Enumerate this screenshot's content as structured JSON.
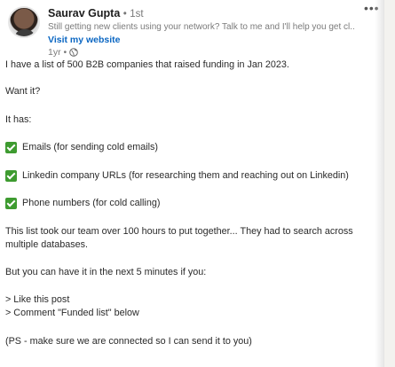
{
  "author": {
    "name": "Saurav Gupta",
    "separator": "•",
    "degree": "1st",
    "headline": "Still getting new clients using your network? Talk to me and I'll help you get cl...",
    "website_link": "Visit my website",
    "time_ago": "1yr •"
  },
  "icons": {
    "menu": "more-horizontal-icon",
    "visibility": "globe-icon",
    "bullet": "check-mark-button-icon"
  },
  "colors": {
    "link": "#0a66c2",
    "check": "#3e9b30"
  },
  "post": {
    "intro": "I have a list of 500 B2B companies that raised funding in Jan 2023.",
    "question": "Want it?",
    "has_label": "It has:",
    "features": [
      "Emails (for sending cold emails)",
      "Linkedin company URLs (for researching them and reaching out on Linkedin)",
      "Phone numbers (for cold calling)"
    ],
    "effort": "This list took our team over 100 hours to put together... They had to search across multiple databases.",
    "offer": "But you can have it in the next 5 minutes if you:",
    "step1": "> Like this post",
    "step2": "> Comment \"Funded list\" below",
    "ps": "(PS - make sure we are connected so I can send it to you)"
  }
}
